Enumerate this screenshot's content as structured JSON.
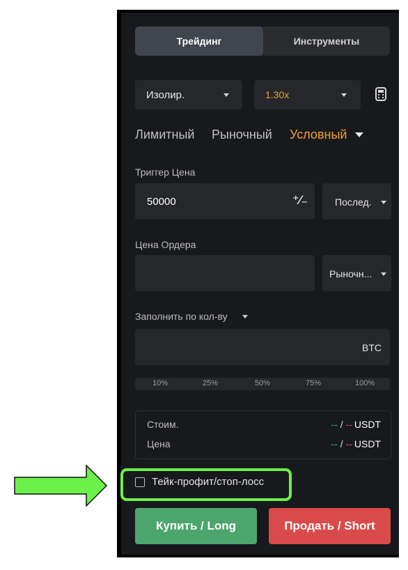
{
  "tabs": [
    "Трейдинг",
    "Инструменты"
  ],
  "margin_mode": "Изолир.",
  "leverage": "1.30x",
  "order_types": {
    "limit": "Лимитный",
    "market": "Рыночный",
    "conditional": "Условный"
  },
  "trigger": {
    "label": "Триггер Цена",
    "value": "50000",
    "price_type": "Послед."
  },
  "order_price": {
    "label": "Цена Ордера",
    "value": "",
    "type": "Рыночн..."
  },
  "quantity": {
    "label": "Заполнить по кол-ву",
    "unit": "BTC",
    "percentages": [
      "10%",
      "25%",
      "50%",
      "75%",
      "100%"
    ]
  },
  "summary": {
    "cost_label": "Стоим.",
    "price_label": "Цена",
    "cost_value": {
      "left": "--",
      "sep": " / ",
      "right": "--",
      "unit": "USDT"
    },
    "price_value": {
      "left": "--",
      "sep": " / ",
      "right": "--",
      "unit": "USDT"
    }
  },
  "tpsl_label": "Тейк-профит/стоп-лосс",
  "buy_label": "Купить / Long",
  "sell_label": "Продать / Short",
  "colors": {
    "accent": "#f0a030",
    "buy": "#4da56e",
    "sell": "#d94b4b",
    "highlight": "#6cf04a",
    "arrow": "#6cf04a"
  }
}
